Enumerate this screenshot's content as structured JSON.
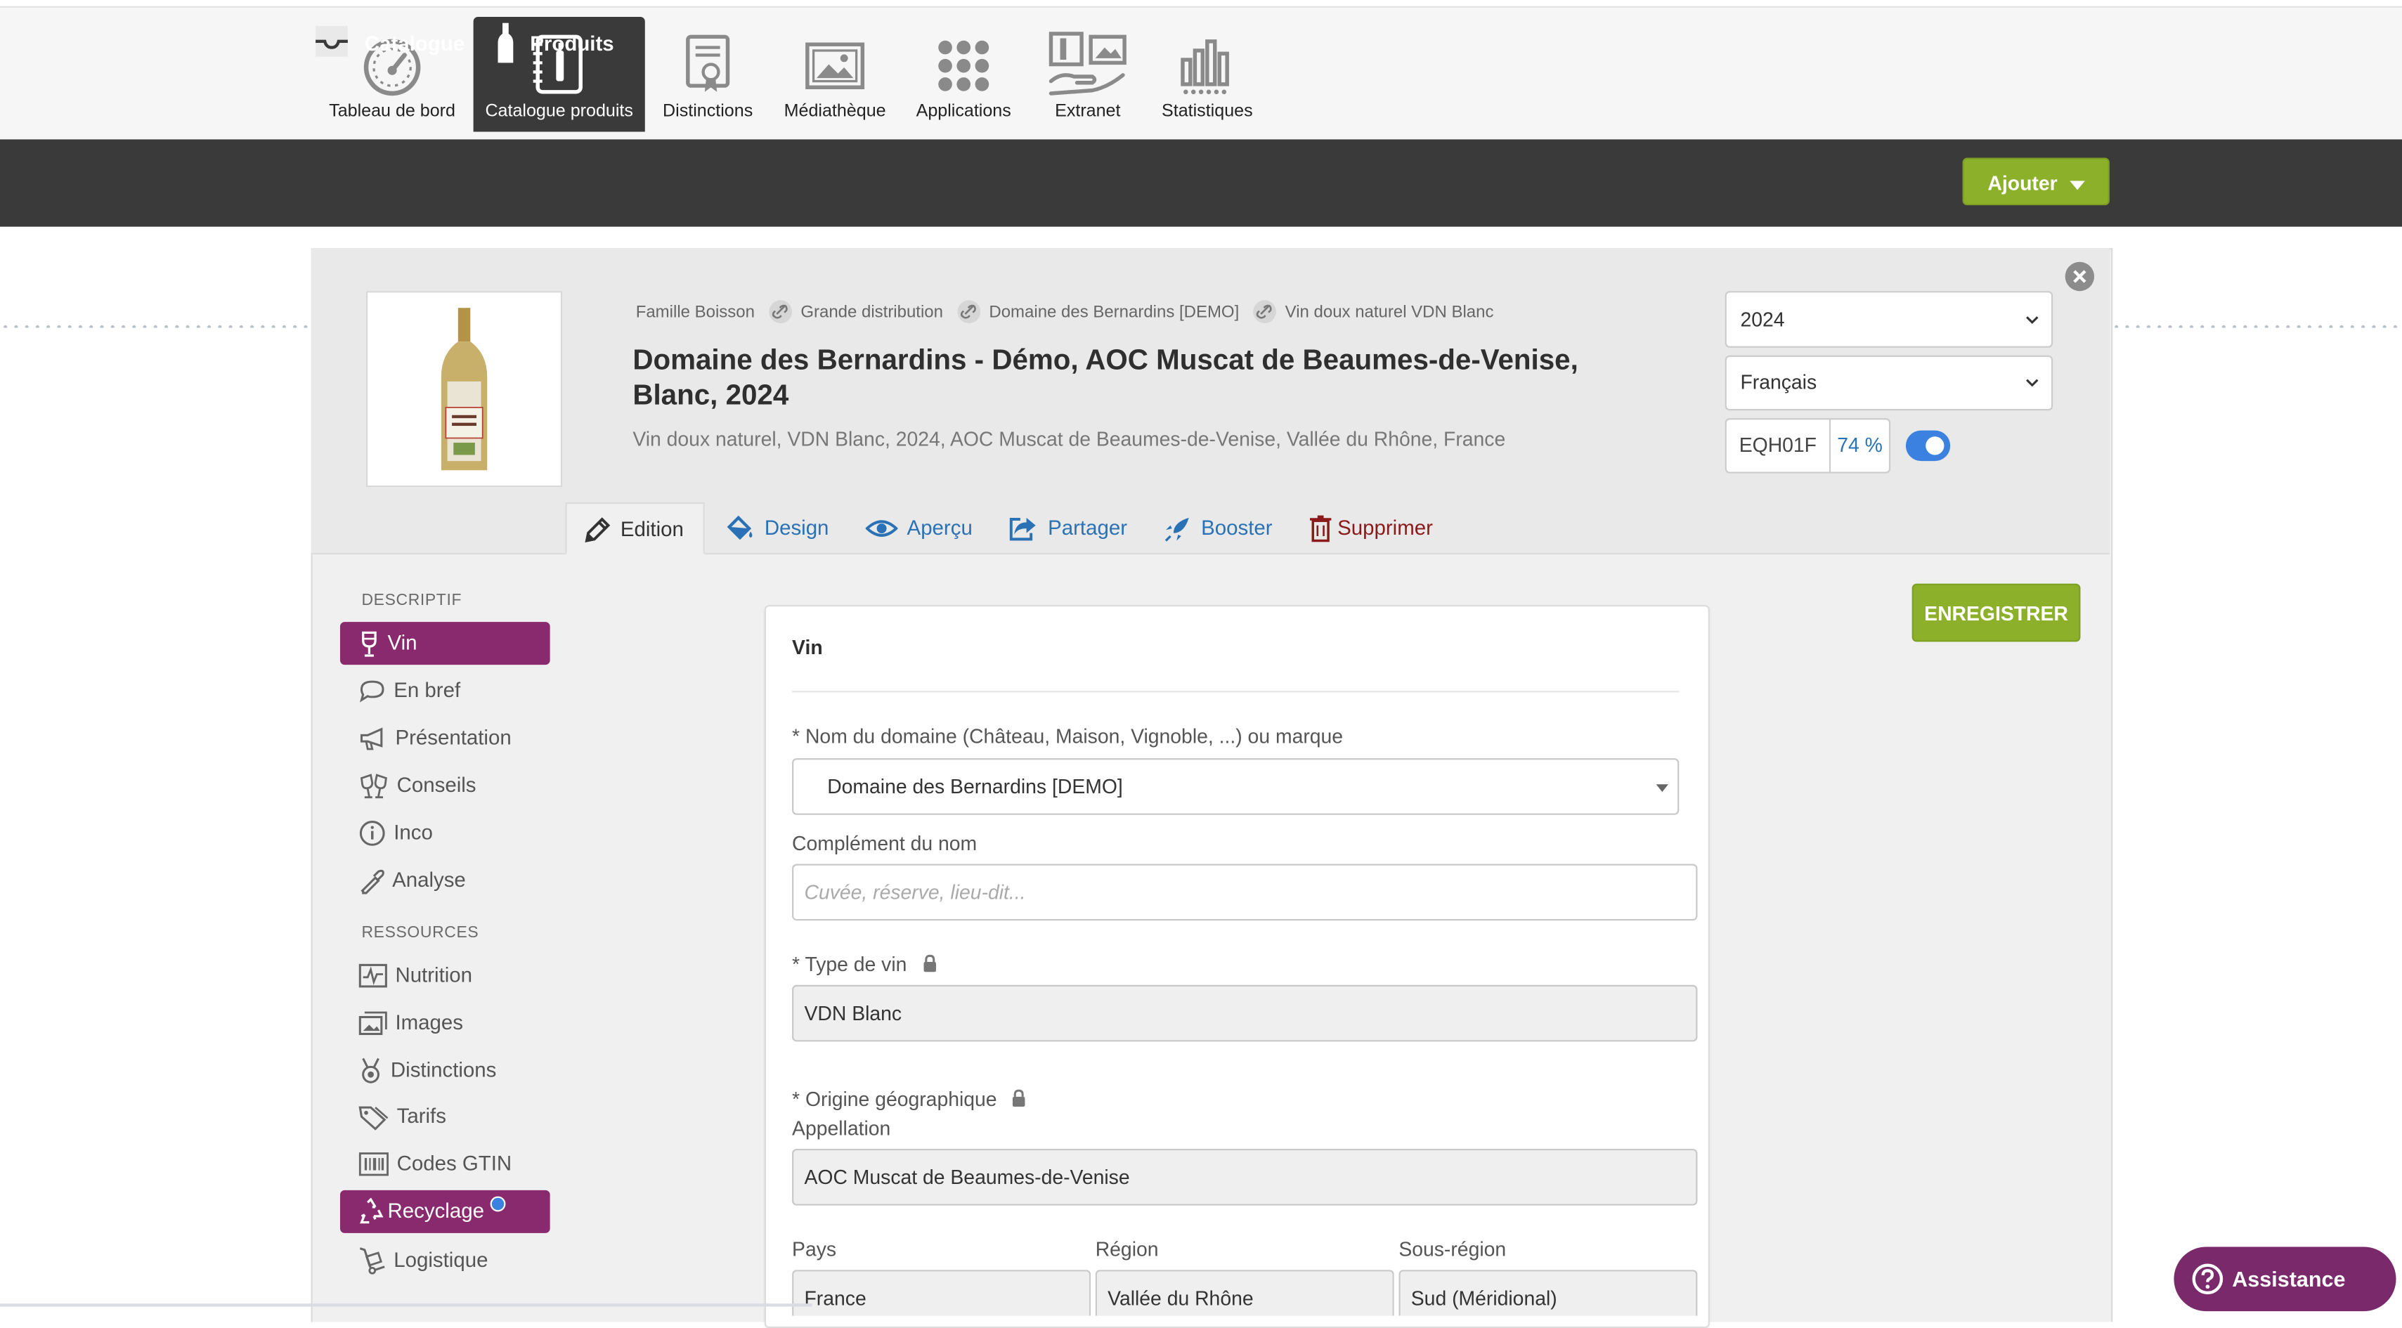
{
  "topnav": {
    "items": [
      {
        "label": "Tableau de bord",
        "icon": "dashboard-gauge-icon"
      },
      {
        "label": "Catalogue produits",
        "icon": "catalog-book-icon",
        "active": true
      },
      {
        "label": "Distinctions",
        "icon": "certificate-icon"
      },
      {
        "label": "Médiathèque",
        "icon": "image-gallery-icon"
      },
      {
        "label": "Applications",
        "icon": "apps-grid-icon"
      },
      {
        "label": "Extranet",
        "icon": "extranet-share-icon"
      },
      {
        "label": "Statistiques",
        "icon": "bar-chart-icon"
      }
    ]
  },
  "subnav": {
    "catalogue": "Catalogue",
    "produits": "Produits",
    "add_button": "Ajouter"
  },
  "product": {
    "breadcrumbs": [
      "Famille Boisson",
      "Grande distribution",
      "Domaine des Bernardins [DEMO]",
      "Vin doux naturel VDN Blanc"
    ],
    "title": "Domaine des Bernardins - Démo, AOC Muscat de Beaumes-de-Venise, Blanc, 2024",
    "subtitle": "Vin doux naturel, VDN Blanc, 2024, AOC Muscat de Beaumes-de-Venise, Vallée du Rhône, France",
    "year": "2024",
    "language": "Français",
    "code": "EQH01F",
    "completion": "74 %",
    "published": true
  },
  "tabs": {
    "edition": "Edition",
    "design": "Design",
    "apercu": "Aperçu",
    "partager": "Partager",
    "booster": "Booster",
    "supprimer": "Supprimer"
  },
  "sidebar": {
    "descriptif_heading": "DESCRIPTIF",
    "ressources_heading": "RESSOURCES",
    "descriptif": [
      "Vin",
      "En bref",
      "Présentation",
      "Conseils",
      "Inco",
      "Analyse"
    ],
    "ressources": [
      "Nutrition",
      "Images",
      "Distinctions",
      "Tarifs",
      "Codes GTIN",
      "Recyclage",
      "Logistique"
    ]
  },
  "save_button": "ENREGISTRER",
  "form": {
    "section_title": "Vin",
    "domain_label": "* Nom du domaine (Château, Maison, Vignoble, ...) ou marque",
    "domain_value": "Domaine des Bernardins [DEMO]",
    "complement_label": "Complément du nom",
    "complement_placeholder": "Cuvée, réserve, lieu-dit...",
    "type_label": "* Type de vin",
    "type_value": "VDN Blanc",
    "origin_label": "* Origine géographique",
    "appellation_label": "Appellation",
    "appellation_value": "AOC Muscat de Beaumes-de-Venise",
    "pays_label": "Pays",
    "pays_value": "France",
    "region_label": "Région",
    "region_value": "Vallée du Rhône",
    "sousregion_label": "Sous-région",
    "sousregion_value": "Sud (Méridional)"
  },
  "assistance": "Assistance",
  "colors": {
    "accent_green": "#8cb029",
    "accent_purple": "#8a2a6e",
    "dark_bar": "#3a3a3a",
    "link_blue": "#2a72b5",
    "danger_red": "#8b1a1a"
  }
}
